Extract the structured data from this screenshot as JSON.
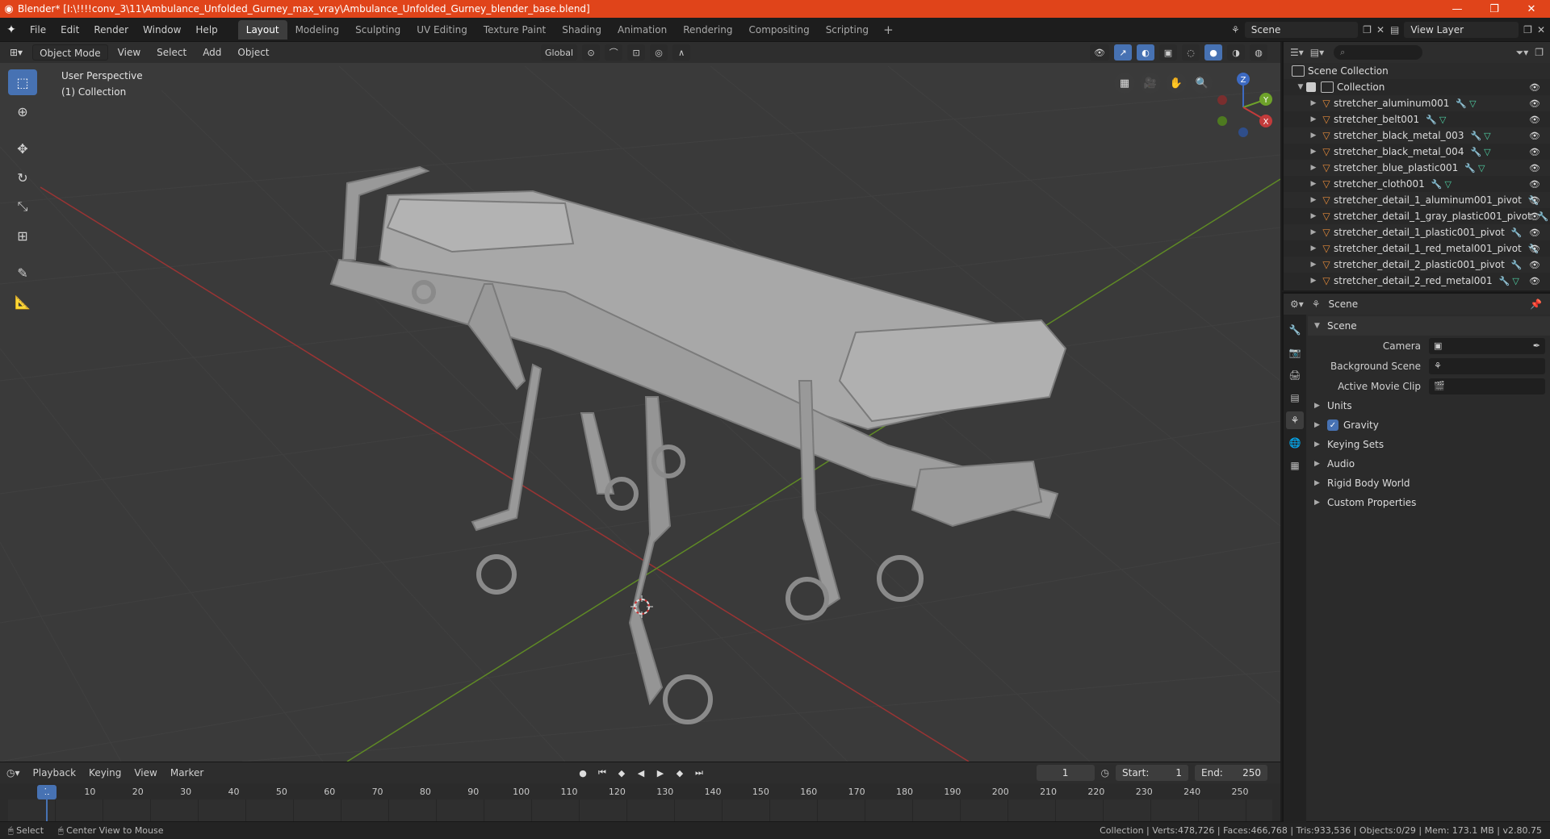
{
  "window": {
    "title": "Blender* [I:\\!!!!conv_3\\11\\Ambulance_Unfolded_Gurney_max_vray\\Ambulance_Unfolded_Gurney_blender_base.blend]",
    "minimize": "—",
    "maximize": "❐",
    "close": "✕"
  },
  "menu": {
    "file": "File",
    "edit": "Edit",
    "render": "Render",
    "window": "Window",
    "help": "Help"
  },
  "workspaces": [
    "Layout",
    "Modeling",
    "Sculpting",
    "UV Editing",
    "Texture Paint",
    "Shading",
    "Animation",
    "Rendering",
    "Compositing",
    "Scripting"
  ],
  "active_workspace": "Layout",
  "scene_selector": {
    "value": "Scene"
  },
  "view_layer_selector": {
    "value": "View Layer"
  },
  "viewport": {
    "mode": "Object Mode",
    "menus": {
      "view": "View",
      "select": "Select",
      "add": "Add",
      "object": "Object"
    },
    "transform_orientation": "Global",
    "info_line1": "User Perspective",
    "info_line2": "(1) Collection",
    "gizmo": {
      "z": "Z",
      "y": "Y",
      "x": "X"
    }
  },
  "timeline": {
    "menus": {
      "playback": "Playback",
      "keying": "Keying",
      "view": "View",
      "marker": "Marker"
    },
    "current_frame": "1",
    "start_label": "Start:",
    "start": "1",
    "end_label": "End:",
    "end": "250",
    "ticks": [
      "1",
      "10",
      "20",
      "30",
      "40",
      "50",
      "60",
      "70",
      "80",
      "90",
      "100",
      "110",
      "120",
      "130",
      "140",
      "150",
      "160",
      "170",
      "180",
      "190",
      "200",
      "210",
      "220",
      "230",
      "240",
      "250"
    ]
  },
  "statusbar": {
    "select": "Select",
    "center_view": "Center View to Mouse",
    "stats": "Collection | Verts:478,726 | Faces:466,768 | Tris:933,536 | Objects:0/29 | Mem: 173.1 MB | v2.80.75"
  },
  "outliner": {
    "root": "Scene Collection",
    "collection": "Collection",
    "items": [
      {
        "name": "stretcher_aluminum001",
        "mesh": true
      },
      {
        "name": "stretcher_belt001",
        "mesh": true
      },
      {
        "name": "stretcher_black_metal_003",
        "mesh": true
      },
      {
        "name": "stretcher_black_metal_004",
        "mesh": true
      },
      {
        "name": "stretcher_blue_plastic001",
        "mesh": true
      },
      {
        "name": "stretcher_cloth001",
        "mesh": true
      },
      {
        "name": "stretcher_detail_1_aluminum001_pivot",
        "mesh": false
      },
      {
        "name": "stretcher_detail_1_gray_plastic001_pivot",
        "mesh": false
      },
      {
        "name": "stretcher_detail_1_plastic001_pivot",
        "mesh": false
      },
      {
        "name": "stretcher_detail_1_red_metal001_pivot",
        "mesh": false
      },
      {
        "name": "stretcher_detail_2_plastic001_pivot",
        "mesh": false
      },
      {
        "name": "stretcher_detail_2_red_metal001",
        "mesh": true
      }
    ]
  },
  "properties": {
    "header": "Scene",
    "section": "Scene",
    "camera_label": "Camera",
    "background_scene_label": "Background Scene",
    "active_clip_label": "Active Movie Clip",
    "subsections": {
      "units": "Units",
      "gravity": "Gravity",
      "keying_sets": "Keying Sets",
      "audio": "Audio",
      "rigid_body_world": "Rigid Body World",
      "custom_properties": "Custom Properties"
    },
    "gravity_enabled": true
  },
  "colors": {
    "accent": "#4772b3",
    "titlebar": "#e0441a",
    "mesh": "#a8a8a8",
    "axis_x": "#b93a3a",
    "axis_y": "#6e9a2c"
  }
}
